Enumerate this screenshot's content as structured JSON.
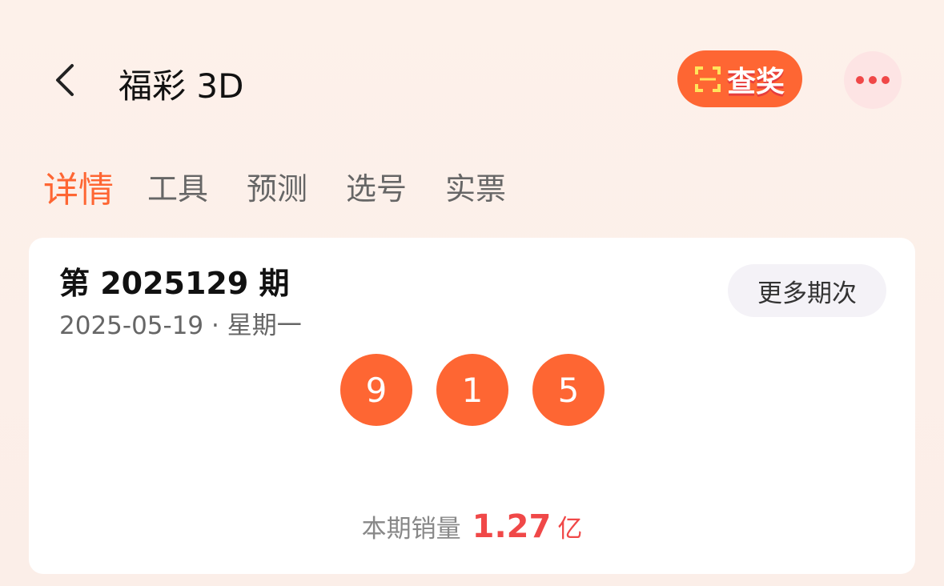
{
  "header": {
    "title": "福彩 3D",
    "scan_label": "查奖"
  },
  "tabs": [
    {
      "label": "详情",
      "active": true
    },
    {
      "label": "工具"
    },
    {
      "label": "预测"
    },
    {
      "label": "选号"
    },
    {
      "label": "实票"
    }
  ],
  "card": {
    "issue": "第 2025129 期",
    "date": "2025-05-19 · 星期一",
    "more_label": "更多期次",
    "numbers": [
      "9",
      "1",
      "5"
    ],
    "sales_label": "本期销量",
    "sales_value": "1.27",
    "sales_unit": "亿"
  },
  "colors": {
    "accent": "#fe6633",
    "sales": "#f04848"
  }
}
